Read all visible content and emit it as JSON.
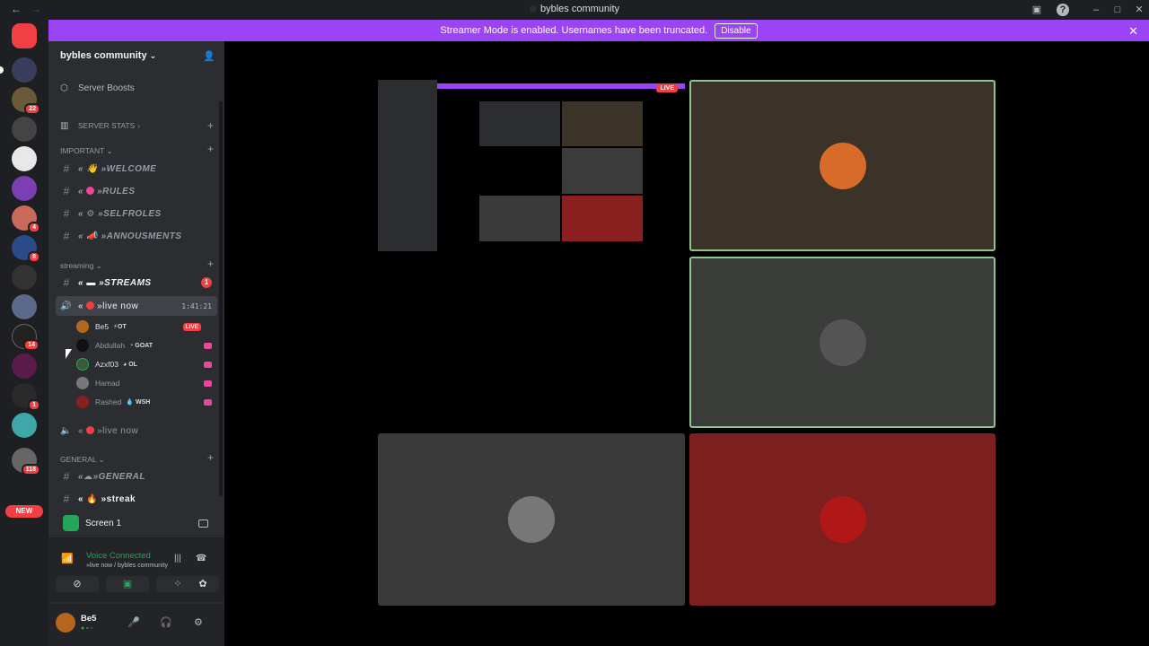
{
  "titlebar": {
    "title": "bybles community",
    "back_icon": "arrow-left-icon",
    "forward_icon": "arrow-right-icon"
  },
  "banner": {
    "text": "Streamer Mode is enabled. Usernames have been truncated.",
    "button_label": "Disable"
  },
  "guilds": {
    "badges": [
      "22",
      "4",
      "8",
      "14",
      "1",
      "118"
    ],
    "new_label": "NEW"
  },
  "sidebar": {
    "server_name": "bybles community",
    "server_boosts": "Server Boosts",
    "server_stats": "SERVER STATS",
    "categories": {
      "important": "IMPORTANT",
      "streaming": "streaming",
      "general": "GENERAL"
    },
    "channels": {
      "welcome": "»WELCOME",
      "rules": "»RULES",
      "selfroles": "»SELFROLES",
      "announcements": "»ANNOUSMENTS",
      "streams": "»STREAMS",
      "streams_badge": "1",
      "live_now": "»live now",
      "live_now_timer": "1:41:21",
      "live_now_2": "»live now",
      "general": "»GENERAL",
      "streak": "»streak"
    },
    "voice_users": [
      {
        "name": "Be5",
        "tag": "OT",
        "live": "LIVE"
      },
      {
        "name": "Abdullah",
        "tag": "GOAT"
      },
      {
        "name": "Azxf03",
        "tag": "OL"
      },
      {
        "name": "Hamad",
        "tag": ""
      },
      {
        "name": "Rashed",
        "tag": "WSH"
      }
    ]
  },
  "screen_share": {
    "label": "Screen 1"
  },
  "voice_panel": {
    "status": "Voice Connected",
    "location": "»live now / bybles community"
  },
  "user_panel": {
    "name": "Be5"
  },
  "stage": {
    "live_label": "LIVE"
  }
}
